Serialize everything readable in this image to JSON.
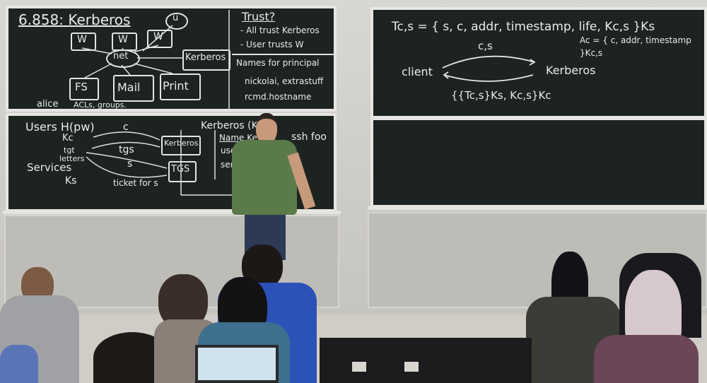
{
  "board_top_left": {
    "title": "6.858: Kerberos",
    "nodes": [
      "W",
      "W",
      "W",
      "u",
      "net",
      "Kerberos",
      "FS",
      "Mail",
      "Print"
    ],
    "caption": "alice",
    "caption2": "ACLs, groups."
  },
  "board_top_middle": {
    "heading": "Trust?",
    "line1": "- All trust Kerberos",
    "line2": "- User trusts W",
    "names_heading": "Names for principal",
    "names_line1": "nickolai, extrastuff",
    "names_line2": "rcmd.hostname"
  },
  "board_bottom_left": {
    "users": "Users H(pw)",
    "kc": "Kc",
    "tgt": "tgt",
    "letters": "letters",
    "services": "Services",
    "ks": "Ks",
    "c": "c",
    "tgs": "tgs",
    "s": "s",
    "ticket": "ticket for s",
    "kerberos_box": "Kerberos",
    "tgs_box": "TGS",
    "kerberos_k": "Kerberos (K",
    "name_key": "Name  Key",
    "user": "user",
    "service": "servi",
    "ssh": "ssh foo"
  },
  "board_top_right": {
    "formula": "Tc,s = { s, c, addr, timestamp, life, Kc,s }Ks",
    "auth": "Ac = { c, addr, timestamp }Kc,s",
    "cs": "c,s",
    "client": "client",
    "kerberos": "Kerberos",
    "reply": "{{Tc,s}Ks, Kc,s}Kc"
  }
}
